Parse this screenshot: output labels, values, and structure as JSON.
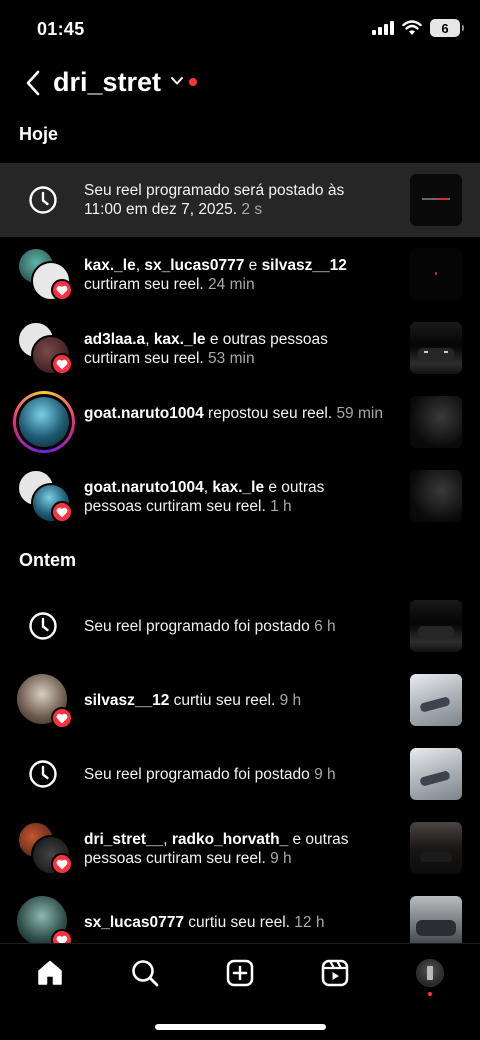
{
  "status_bar": {
    "time": "01:45",
    "battery": "6"
  },
  "header": {
    "account": "dri_stret"
  },
  "sections": {
    "today": "Hoje",
    "yesterday": "Ontem"
  },
  "notifications": [
    {
      "pre": "Seu reel programado será postado às 11:00 em dez 7, 2025.",
      "time": "2 s"
    },
    {
      "user1": "kax._le",
      "sep1": ", ",
      "user2": "sx_lucas0777",
      "mid": " e ",
      "user3": "silvasz__12",
      "action": " curtiram seu reel.",
      "time": "24 min"
    },
    {
      "user1": "ad3laa.a",
      "sep1": ", ",
      "user2": "kax._le",
      "action": " e outras pessoas curtiram seu reel.",
      "time": "53 min"
    },
    {
      "user1": "goat.naruto1004",
      "action": " repostou seu reel.",
      "time": "59 min"
    },
    {
      "user1": "goat.naruto1004",
      "sep1": ", ",
      "user2": "kax._le",
      "action": " e outras pessoas curtiram seu reel.",
      "time": "1 h"
    },
    {
      "pre": "Seu reel programado foi postado",
      "time": "6 h"
    },
    {
      "user1": "silvasz__12",
      "action": " curtiu seu reel.",
      "time": "9 h"
    },
    {
      "pre": "Seu reel programado foi postado",
      "time": "9 h"
    },
    {
      "user1": "dri_stret__",
      "sep1": ", ",
      "user2": "radko_horvath_",
      "action": " e outras pessoas curtiram seu reel.",
      "time": "9 h"
    },
    {
      "user1": "sx_lucas0777",
      "action": " curtiu seu reel.",
      "time": "12 h"
    }
  ],
  "icons": {
    "back": "chevron-left-icon",
    "account_menu": "chevron-down-icon",
    "scheduled": "clock-icon",
    "like_badge": "heart-icon",
    "tabs": [
      "home-icon",
      "search-icon",
      "create-icon",
      "reels-icon",
      "profile-avatar"
    ]
  },
  "colors": {
    "accent_red": "#ff3040",
    "background": "#000000",
    "highlight": "#262626",
    "secondary_text": "#a8a8a8"
  }
}
